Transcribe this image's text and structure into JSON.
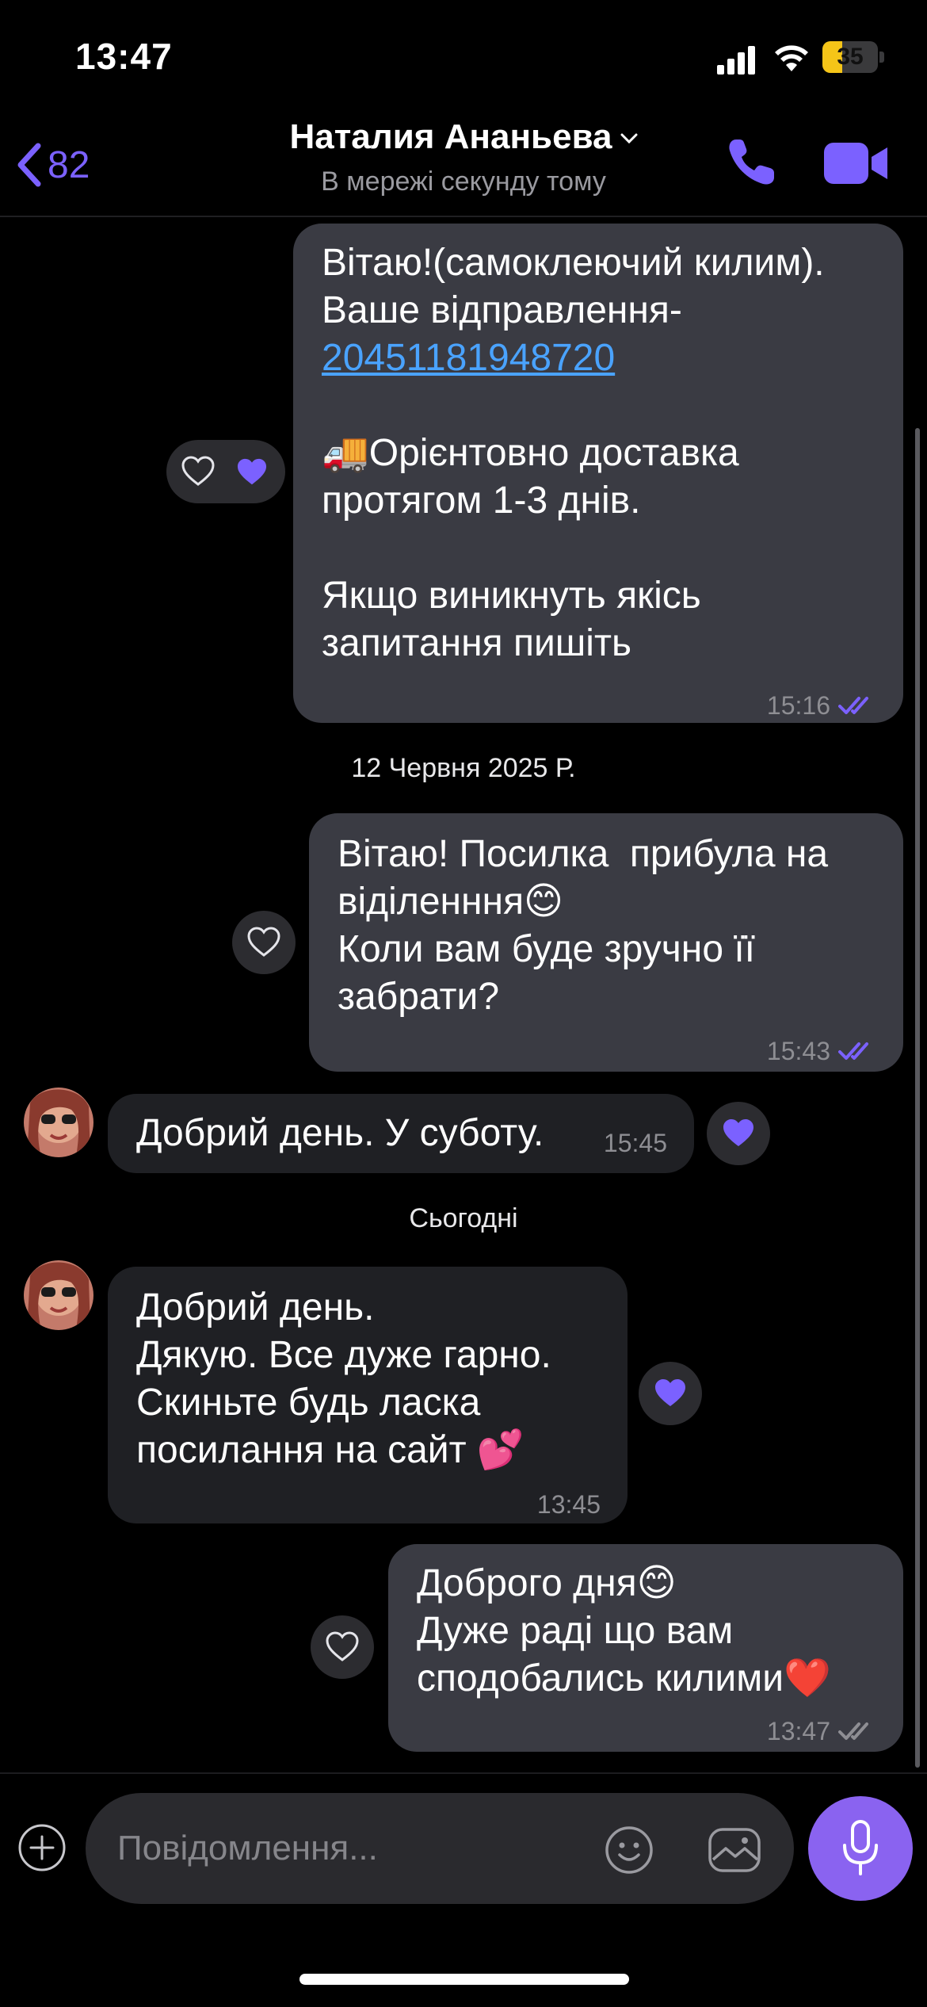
{
  "status_bar": {
    "time": "13:47",
    "battery": "35"
  },
  "header": {
    "back_count": "82",
    "contact_name": "Наталия Ананьева",
    "status": "В мережі секунду тому"
  },
  "messages": [
    {
      "lines": [
        "Вітаю!(самоклеючий килим).",
        "Ваше відправлення-",
        "20451181948720",
        "",
        "🚚Орієнтовно доставка",
        "протягом 1-3 днів.",
        "",
        "Якщо виникнуть якісь",
        "запитання пишіть"
      ],
      "time": "15:16"
    },
    {
      "lines": [
        "Вітаю! Посилка  прибула на",
        "віділенння😊",
        "Коли вам буде зручно її",
        "забрати?"
      ],
      "time": "15:43"
    },
    {
      "lines": [
        "Добрий день. У суботу."
      ],
      "time": "15:45"
    },
    {
      "lines": [
        "Добрий день.",
        "Дякую. Все дуже гарно.",
        "Скиньте будь ласка",
        "посилання на сайт 💕"
      ],
      "time": "13:45"
    },
    {
      "lines": [
        "Доброго дня😊",
        "Дуже раді що вам",
        "сподобались килими❤️"
      ],
      "time": "13:47"
    }
  ],
  "date_separators": [
    "12 Червня 2025 Р.",
    "Сьогодні"
  ],
  "composer": {
    "placeholder": "Повідомлення..."
  },
  "colors": {
    "accent": "#7b61ff",
    "outgoing_bubble": "#3a3b43",
    "incoming_bubble": "#1f2024",
    "link": "#4aa3ff"
  }
}
